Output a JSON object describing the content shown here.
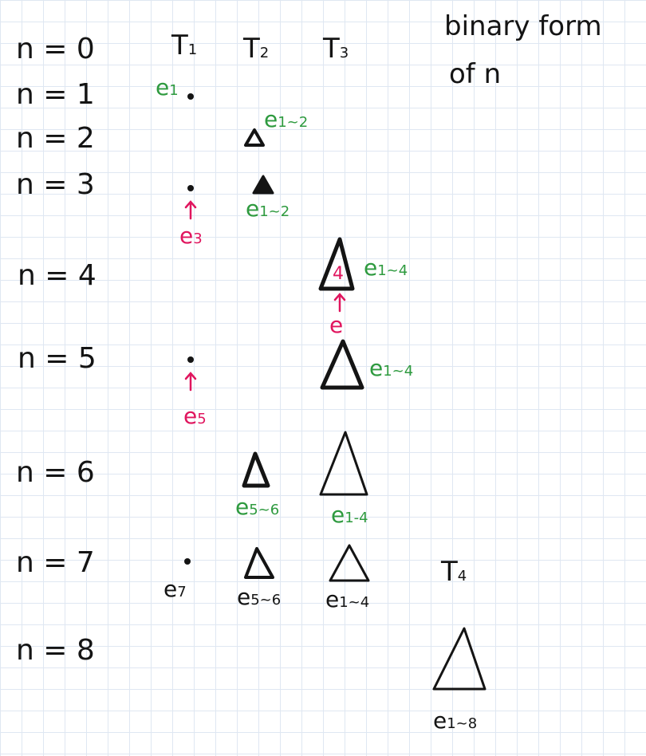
{
  "columns": [
    {
      "id": "t1",
      "main": "T",
      "sub": "1"
    },
    {
      "id": "t2",
      "main": "T",
      "sub": "2"
    },
    {
      "id": "t3",
      "main": "T",
      "sub": "3"
    },
    {
      "id": "t4",
      "main": "T",
      "sub": "4"
    }
  ],
  "note": {
    "line1": "binary form",
    "line2": "of n"
  },
  "rows": [
    {
      "id": "r0",
      "label": "n = 0"
    },
    {
      "id": "r1",
      "label": "n = 1"
    },
    {
      "id": "r2",
      "label": "n = 2"
    },
    {
      "id": "r3",
      "label": "n = 3"
    },
    {
      "id": "r4",
      "label": "n = 4"
    },
    {
      "id": "r5",
      "label": "n = 5"
    },
    {
      "id": "r6",
      "label": "n = 6"
    },
    {
      "id": "r7",
      "label": "n = 7"
    },
    {
      "id": "r8",
      "label": "n = 8"
    }
  ],
  "annotations": {
    "r1_t1": {
      "main": "e",
      "sub": "1"
    },
    "r2_t2": {
      "main": "e",
      "sub": "1~2"
    },
    "r3_t2": {
      "main": "e",
      "sub": "1~2"
    },
    "r3_t1": {
      "main": "e",
      "sub": "3"
    },
    "r4_t3": {
      "main": "e",
      "sub": "1~4"
    },
    "r4_t3_inner": "4",
    "r4_arrow": {
      "main": "e",
      "sub": ""
    },
    "r5_t3": {
      "main": "e",
      "sub": "1~4"
    },
    "r5_t1": {
      "main": "e",
      "sub": "5"
    },
    "r6_t2": {
      "main": "e",
      "sub": "5~6"
    },
    "r6_t3": {
      "main": "e",
      "sub": "1-4"
    },
    "r7_t1": {
      "main": "e",
      "sub": "7"
    },
    "r7_t2": {
      "main": "e",
      "sub": "5~6"
    },
    "r7_t3": {
      "main": "e",
      "sub": "1~4"
    },
    "r8_t4": {
      "main": "e",
      "sub": "1~8"
    }
  },
  "colors": {
    "ink": "#141414",
    "green": "#2e9a3f",
    "pink": "#e0155e",
    "grid": "#dfe7f2"
  }
}
